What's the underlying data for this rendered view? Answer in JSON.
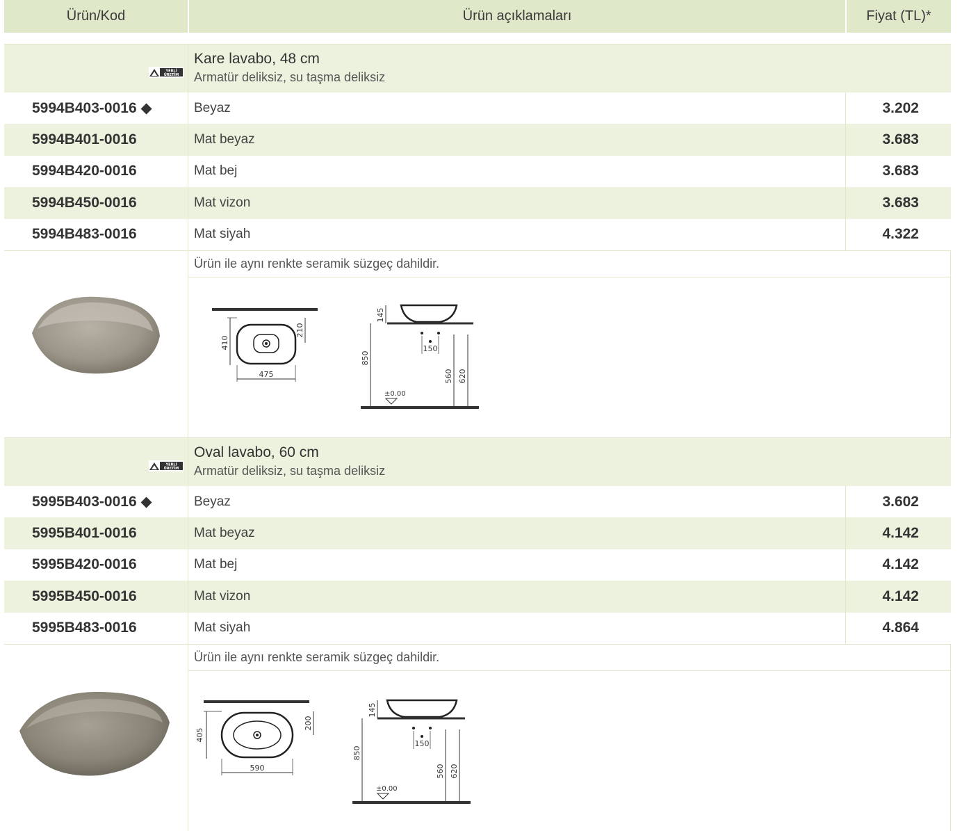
{
  "header": {
    "code": "Ürün/Kod",
    "desc": "Ürün açıklamaları",
    "price": "Fiyat (TL)*"
  },
  "badge": {
    "line1": "YERLİ",
    "line2": "ÜRETİM"
  },
  "sections": [
    {
      "title": "Kare lavabo, 48 cm",
      "subtitle": "Armatür deliksiz, su taşma deliksiz",
      "rows": [
        {
          "code": "5994B403-0016 ◆",
          "desc": "Beyaz",
          "price": "3.202"
        },
        {
          "code": "5994B401-0016",
          "desc": "Mat beyaz",
          "price": "3.683"
        },
        {
          "code": "5994B420-0016",
          "desc": "Mat bej",
          "price": "3.683"
        },
        {
          "code": "5994B450-0016",
          "desc": "Mat vizon",
          "price": "3.683"
        },
        {
          "code": "5994B483-0016",
          "desc": "Mat siyah",
          "price": "4.322"
        }
      ],
      "note": "Ürün ile aynı renkte seramik süzgeç dahildir.",
      "dims": {
        "width": "475",
        "depth": "410",
        "half": "210",
        "height": "145",
        "total": "850",
        "spacing": "150",
        "h1": "560",
        "h2": "620",
        "zero": "±0.00"
      }
    },
    {
      "title": "Oval lavabo, 60 cm",
      "subtitle": "Armatür deliksiz, su taşma deliksiz",
      "rows": [
        {
          "code": "5995B403-0016 ◆",
          "desc": "Beyaz",
          "price": "3.602"
        },
        {
          "code": "5995B401-0016",
          "desc": "Mat beyaz",
          "price": "4.142"
        },
        {
          "code": "5995B420-0016",
          "desc": "Mat bej",
          "price": "4.142"
        },
        {
          "code": "5995B450-0016",
          "desc": "Mat vizon",
          "price": "4.142"
        },
        {
          "code": "5995B483-0016",
          "desc": "Mat siyah",
          "price": "4.864"
        }
      ],
      "note": "Ürün ile aynı renkte seramik süzgeç dahildir.",
      "dims": {
        "width": "590",
        "depth": "405",
        "half": "200",
        "height": "145",
        "total": "850",
        "spacing": "150",
        "h1": "560",
        "h2": "620",
        "zero": "±0.00"
      }
    }
  ]
}
